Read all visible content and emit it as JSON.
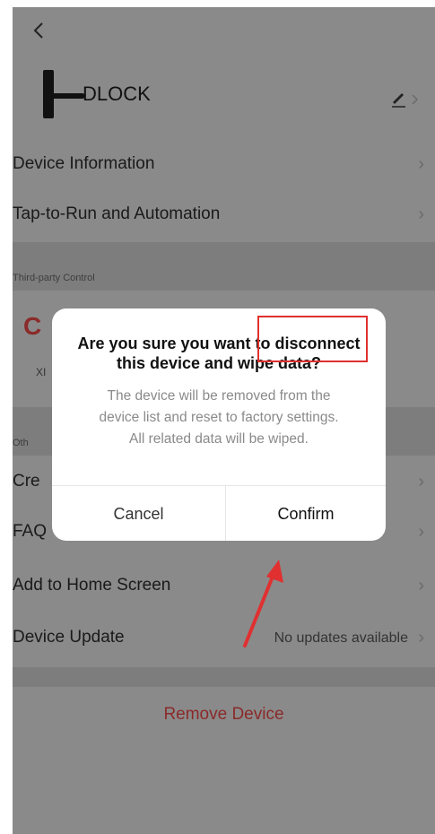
{
  "header": {
    "back_icon": "chevron-left-icon",
    "device_name": "DLOCK",
    "edit_icon": "pencil-icon"
  },
  "menu_top": [
    {
      "label": "Device Information"
    },
    {
      "label": "Tap-to-Run and Automation"
    }
  ],
  "third_party": {
    "section_label": "Third-party Control",
    "item_partial": "XI"
  },
  "others": {
    "section_label_partial": "Oth",
    "items": [
      {
        "label": "Cre"
      },
      {
        "label": "FAQ"
      },
      {
        "label": "Add to Home Screen"
      },
      {
        "label": "Device Update",
        "value": "No updates available"
      }
    ]
  },
  "remove_device": {
    "label": "Remove Device",
    "color": "#8b2a2a"
  },
  "dialog": {
    "title_line1": "Are you sure you want to disconnect",
    "title_line2": "this device and wipe data?",
    "body_line1": "The device will be removed from the",
    "body_line2": "device list and reset to factory settings.",
    "body_line3": "All related data will be wiped.",
    "cancel": "Cancel",
    "confirm": "Confirm"
  },
  "annotation": {
    "highlight_color": "#e03030"
  }
}
